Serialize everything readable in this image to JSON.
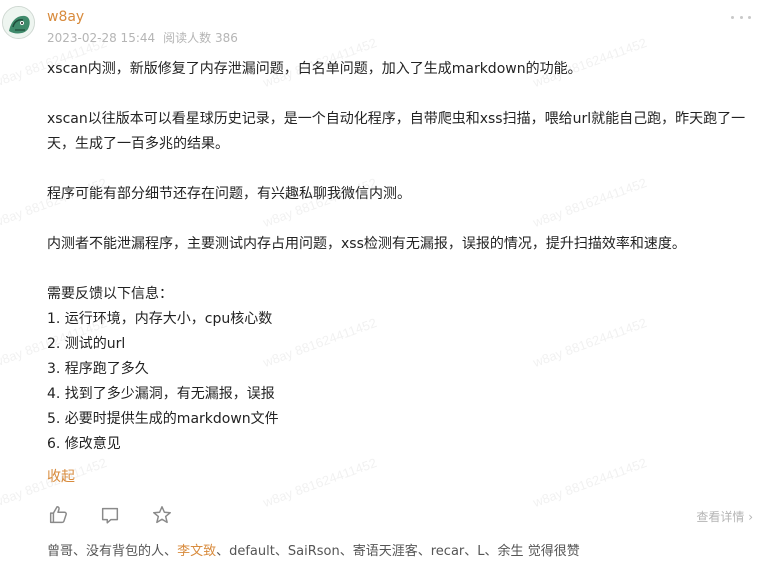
{
  "post": {
    "username": "w8ay",
    "date": "2023-02-28 15:44",
    "reads": "阅读人数 386",
    "paragraphs": [
      "xscan内测，新版修复了内存泄漏问题，白名单问题，加入了生成markdown的功能。",
      "xscan以往版本可以看星球历史记录，是一个自动化程序，自带爬虫和xss扫描，喂给url就能自己跑，昨天跑了一天，生成了一百多兆的结果。",
      "程序可能有部分细节还存在问题，有兴趣私聊我微信内测。",
      "内测者不能泄漏程序，主要测试内存占用问题，xss检测有无漏报，误报的情况，提升扫描效率和速度。"
    ],
    "feedback_title": "需要反馈以下信息：",
    "feedback_items": [
      "1. 运行环境，内存大小，cpu核心数",
      "2. 测试的url",
      "3. 程序跑了多久",
      "4. 找到了多少漏洞，有无漏报，误报",
      "5. 必要时提供生成的markdown文件",
      "6. 修改意见"
    ],
    "collapse_label": "收起"
  },
  "actions": {
    "like_icon": "thumbs-up-icon",
    "comment_icon": "comment-icon",
    "star_icon": "star-icon",
    "details_label": "查看详情 ›"
  },
  "likes": {
    "names": [
      "曾哥",
      "没有背包的人",
      "李文致",
      "default",
      "SaiRson",
      "寄语天涯客",
      "recar",
      "L",
      "余生"
    ],
    "suffix": " 觉得很赞"
  },
  "watermark_text": "w8ay 881624411452",
  "colors": {
    "accent": "#d88b3d",
    "muted": "#b5b5b5",
    "text": "#222222"
  }
}
